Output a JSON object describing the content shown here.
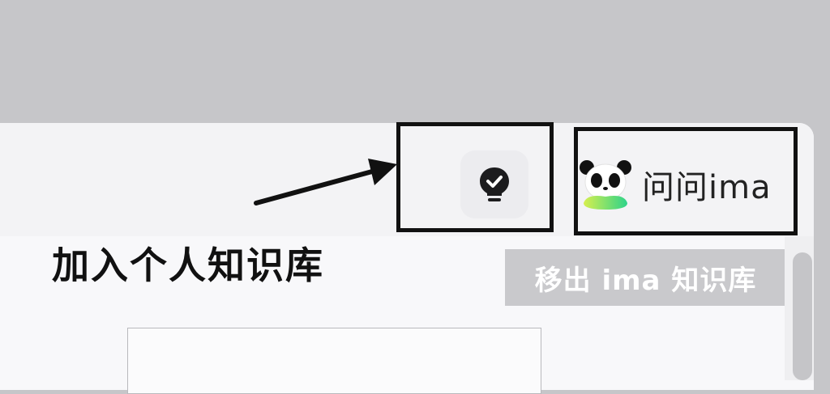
{
  "toolbar": {
    "tip_icon": "lightbulb-check-icon",
    "ask_ima": {
      "icon": "panda-avatar-icon",
      "label": "问问ima"
    }
  },
  "annotation": {
    "text": "加入个人知识库"
  },
  "tooltip": {
    "text": "移出 ima 知识库"
  },
  "colors": {
    "window_bg": "#c6c6c9",
    "panel_bg": "#f8f8fa",
    "frame": "#111111",
    "tooltip_bg": "#c9c9cc",
    "panda_gradient": [
      "#d6ef4f",
      "#2ed389"
    ]
  }
}
